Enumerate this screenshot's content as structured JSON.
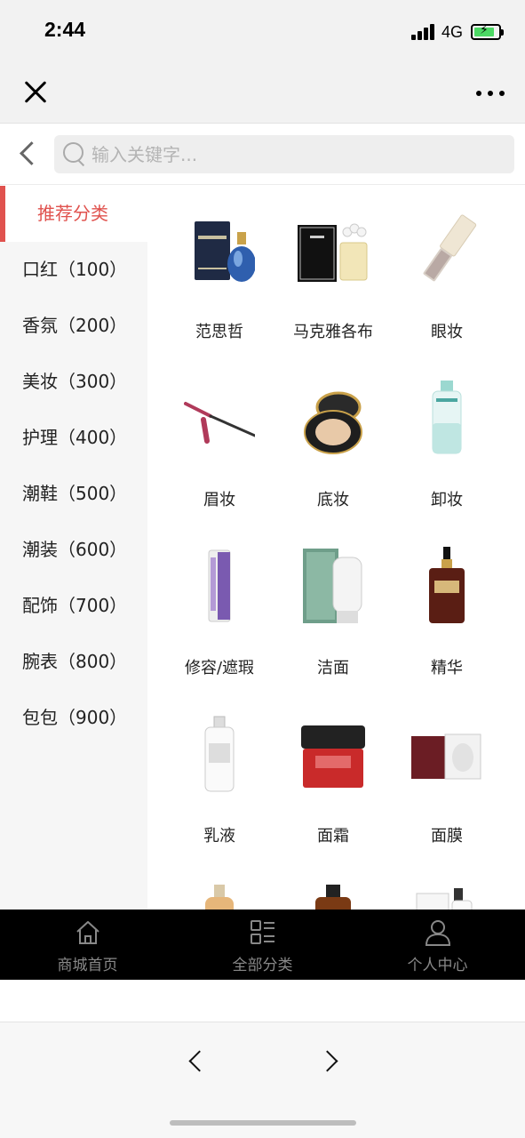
{
  "status_bar": {
    "time": "2:44",
    "network": "4G"
  },
  "search": {
    "placeholder": "输入关键字..."
  },
  "sidebar": {
    "items": [
      {
        "label": "推荐分类",
        "active": true
      },
      {
        "label": "口红（100）"
      },
      {
        "label": "香氛（200）"
      },
      {
        "label": "美妆（300）"
      },
      {
        "label": "护理（400）"
      },
      {
        "label": "潮鞋（500）"
      },
      {
        "label": "潮装（600）"
      },
      {
        "label": "配饰（700）"
      },
      {
        "label": "腕表（800）"
      },
      {
        "label": "包包（900）"
      }
    ]
  },
  "products": [
    {
      "label": "范思哲",
      "icon": "perfume-image"
    },
    {
      "label": "马克雅各布",
      "icon": "perfume-box-image"
    },
    {
      "label": "眼妆",
      "icon": "eye-makeup-image"
    },
    {
      "label": "眉妆",
      "icon": "eyebrow-pencil-image"
    },
    {
      "label": "底妆",
      "icon": "cushion-compact-image"
    },
    {
      "label": "卸妆",
      "icon": "micellar-water-image"
    },
    {
      "label": "修容/遮瑕",
      "icon": "concealer-tube-image"
    },
    {
      "label": "洁面",
      "icon": "cleanser-image"
    },
    {
      "label": "精华",
      "icon": "serum-bottle-image"
    },
    {
      "label": "乳液",
      "icon": "lotion-bottle-image"
    },
    {
      "label": "面霜",
      "icon": "face-cream-jar-image"
    },
    {
      "label": "面膜",
      "icon": "face-mask-image"
    },
    {
      "label": "",
      "icon": "toner-bottle-image"
    },
    {
      "label": "",
      "icon": "essence-bottle-image"
    },
    {
      "label": "",
      "icon": "product-set-image"
    }
  ],
  "tab_bar": {
    "tabs": [
      {
        "label": "商城首页",
        "icon": "home-icon"
      },
      {
        "label": "全部分类",
        "icon": "category-icon"
      },
      {
        "label": "个人中心",
        "icon": "user-icon"
      }
    ]
  },
  "colors": {
    "accent": "#e0524e",
    "tab_bar_bg": "#000000",
    "sidebar_bg": "#f6f6f6"
  }
}
